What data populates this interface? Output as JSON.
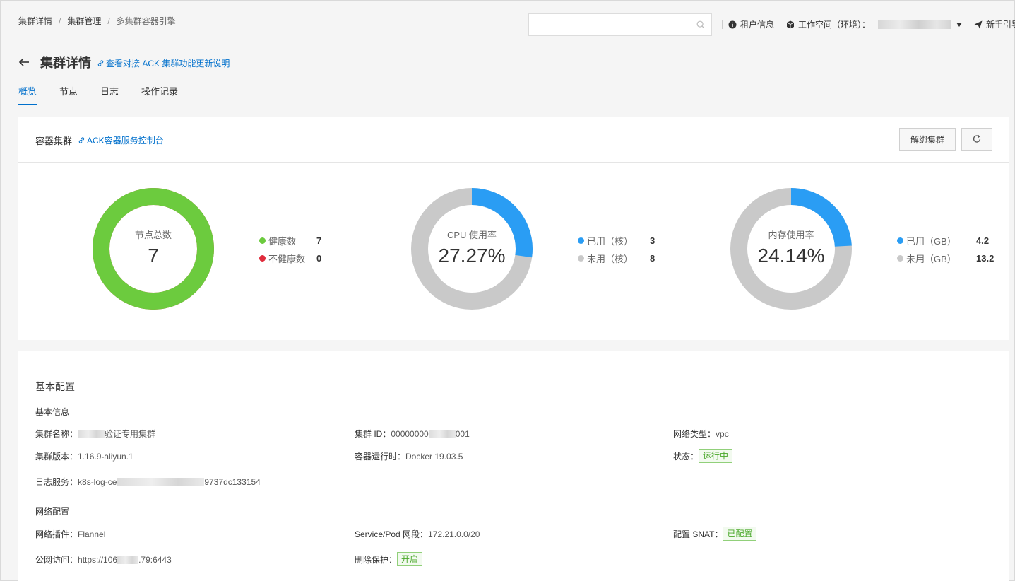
{
  "breadcrumb": {
    "items": [
      "集群详情",
      "集群管理",
      "多集群容器引擎"
    ],
    "separator": "/"
  },
  "search": {
    "placeholder": ""
  },
  "header": {
    "tenant_info": "租户信息",
    "workspace_label": "工作空间（环境）：",
    "guide": "新手引导"
  },
  "page": {
    "title": "集群详情",
    "link": "查看对接 ACK 集群功能更新说明"
  },
  "tabs": [
    {
      "label": "概览",
      "active": true
    },
    {
      "label": "节点",
      "active": false
    },
    {
      "label": "日志",
      "active": false
    },
    {
      "label": "操作记录",
      "active": false
    }
  ],
  "container_cluster": {
    "title": "容器集群",
    "console_link": "ACK容器服务控制台",
    "unbind_button": "解绑集群"
  },
  "colors": {
    "healthy": "#6ccb3e",
    "unhealthy": "#e02c3c",
    "used": "#2a9df4",
    "unused": "#c9c9c9",
    "accent": "#0070cc"
  },
  "nodes": {
    "label": "节点总数",
    "total": "7",
    "healthy_label": "健康数",
    "healthy_value": "7",
    "unhealthy_label": "不健康数",
    "unhealthy_value": "0",
    "healthy_fraction": 1.0
  },
  "cpu": {
    "label": "CPU 使用率",
    "value": "27.27%",
    "used_label": "已用（核）",
    "used_value": "3",
    "unused_label": "未用（核）",
    "unused_value": "8",
    "used_fraction": 0.2727
  },
  "memory": {
    "label": "内存使用率",
    "value": "24.14%",
    "used_label": "已用（GB）",
    "used_value": "4.2",
    "unused_label": "未用（GB）",
    "unused_value": "13.2",
    "used_fraction": 0.2414
  },
  "basic_config": {
    "title": "基本配置",
    "basic_info_title": "基本信息",
    "cluster_name_label": "集群名称：",
    "cluster_name_value": "验证专用集群",
    "cluster_id_label": "集群 ID：",
    "cluster_id_prefix": "00000000",
    "cluster_id_suffix": "001",
    "network_type_label": "网络类型：",
    "network_type_value": "vpc",
    "cluster_version_label": "集群版本：",
    "cluster_version_value": "1.16.9-aliyun.1",
    "runtime_label": "容器运行时：",
    "runtime_value": "Docker 19.03.5",
    "status_label": "状态：",
    "status_value": "运行中",
    "log_service_label": "日志服务：",
    "log_service_prefix": "k8s-log-ce",
    "log_service_suffix": "9737dc133154",
    "network_config_title": "网络配置",
    "network_plugin_label": "网络插件：",
    "network_plugin_value": "Flannel",
    "service_pod_label": "Service/Pod 网段：",
    "service_pod_value": "172.21.0.0/20",
    "snat_label": "配置 SNAT：",
    "snat_value": "已配置",
    "public_access_label": "公网访问：",
    "public_access_prefix": "https://106",
    "public_access_suffix": ".79:6443",
    "delete_protection_label": "删除保护：",
    "delete_protection_value": "开启"
  }
}
